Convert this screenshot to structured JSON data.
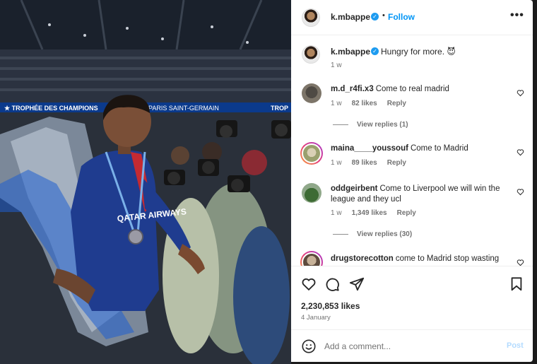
{
  "post": {
    "username": "k.mbappe",
    "follow_label": "Follow",
    "more_label": "•••",
    "caption": "Hungry for more. 😈",
    "caption_time": "1 w",
    "likes": "2,230,853 likes",
    "date": "4 January"
  },
  "photo": {
    "banner_left": "★ TROPHÉE DES CHAMPIONS",
    "banner_mid": "PARIS SAINT-GERMAIN",
    "banner_right": "TROP",
    "jersey_text": "QATAR AIRWAYS"
  },
  "comments": [
    {
      "user": "m.d_r4fi.x3",
      "text": "Come to real madrid",
      "time": "1 w",
      "likes": "82 likes",
      "reply": "Reply",
      "view_replies": "View replies (1)"
    },
    {
      "user": "maina____youssouf",
      "text": "Come to Madrid",
      "time": "1 w",
      "likes": "89 likes",
      "reply": "Reply",
      "view_replies": ""
    },
    {
      "user": "oddgeirbent",
      "text": "Come to Liverpool we will win the",
      "text2": "league and they ucl",
      "time": "1 w",
      "likes": "1,349 likes",
      "reply": "Reply",
      "view_replies": "View replies (30)"
    },
    {
      "user": "drugstorecotton",
      "text": "come to Madrid stop wasting",
      "time": "",
      "likes": "",
      "reply": "",
      "view_replies": ""
    }
  ],
  "add_comment": {
    "placeholder": "Add a comment...",
    "post_label": "Post"
  },
  "icons": [
    "heart-icon",
    "comment-icon",
    "share-icon",
    "bookmark-icon",
    "emoji-icon",
    "verified-icon",
    "more-icon"
  ],
  "colors": {
    "accent": "#0095f6",
    "verified": "#1d9bf0",
    "text": "#262626",
    "muted": "#737373"
  }
}
